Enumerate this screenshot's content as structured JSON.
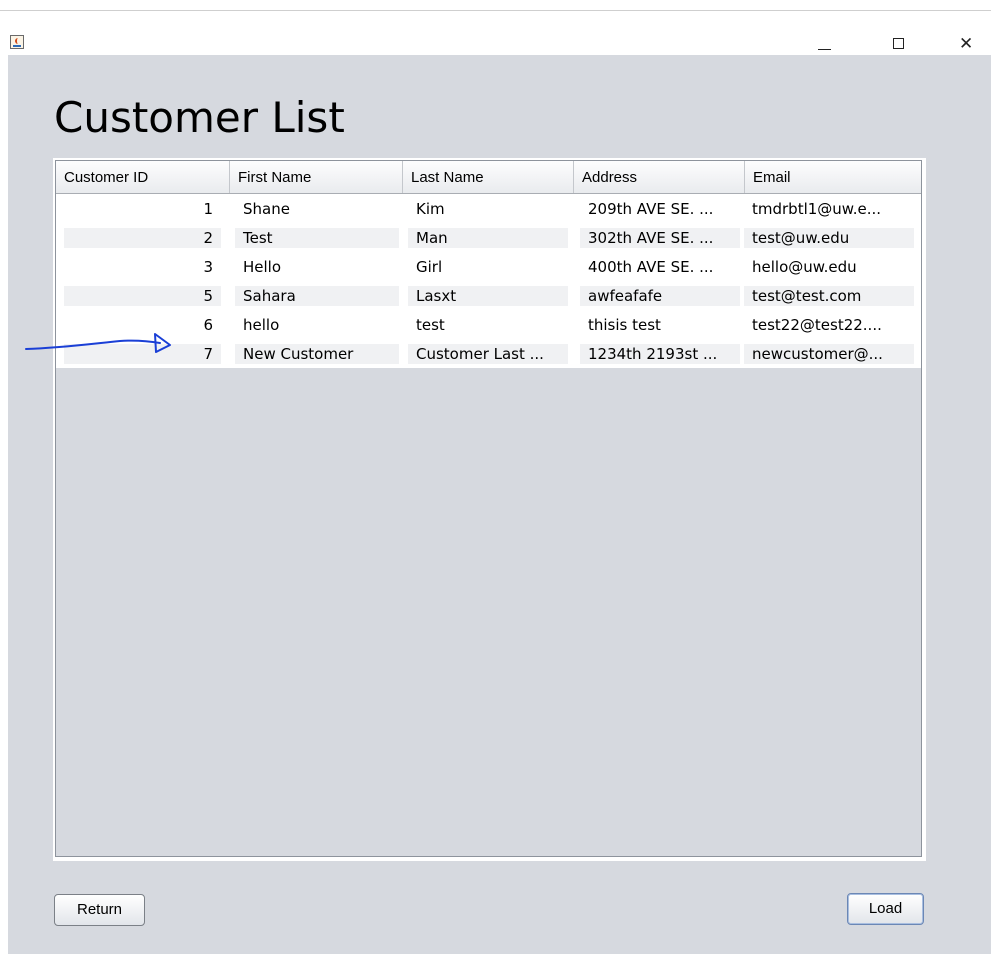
{
  "window": {
    "icon": "java-cup-icon",
    "controls": {
      "minimize": "minimize-icon",
      "maximize": "maximize-icon",
      "close": "close-icon",
      "close_glyph": "✕"
    }
  },
  "page": {
    "title": "Customer List"
  },
  "table": {
    "columns": [
      "Customer ID",
      "First Name",
      "Last Name",
      "Address",
      "Email"
    ],
    "rows": [
      [
        "1",
        "Shane",
        "Kim",
        "209th AVE SE. ...",
        "tmdrbtl1@uw.e..."
      ],
      [
        "2",
        "Test",
        "Man",
        "302th AVE SE. ...",
        "test@uw.edu"
      ],
      [
        "3",
        "Hello",
        "Girl",
        "400th AVE SE. ...",
        "hello@uw.edu"
      ],
      [
        "5",
        "Sahara",
        "Lasxt",
        "awfeafafe",
        "test@test.com"
      ],
      [
        "6",
        "hello",
        "test",
        "thisis test",
        "test22@test22...."
      ],
      [
        "7",
        "New Customer",
        "Customer Last ...",
        "1234th 2193st ...",
        "newcustomer@..."
      ]
    ]
  },
  "buttons": {
    "return_label": "Return",
    "load_label": "Load"
  },
  "colors": {
    "background": "#d6d9df",
    "annotation_arrow": "#1a3fd6",
    "alt_row": "#f0f1f3"
  },
  "annotation": {
    "type": "hand-drawn-arrow",
    "points_to_row": "7"
  }
}
